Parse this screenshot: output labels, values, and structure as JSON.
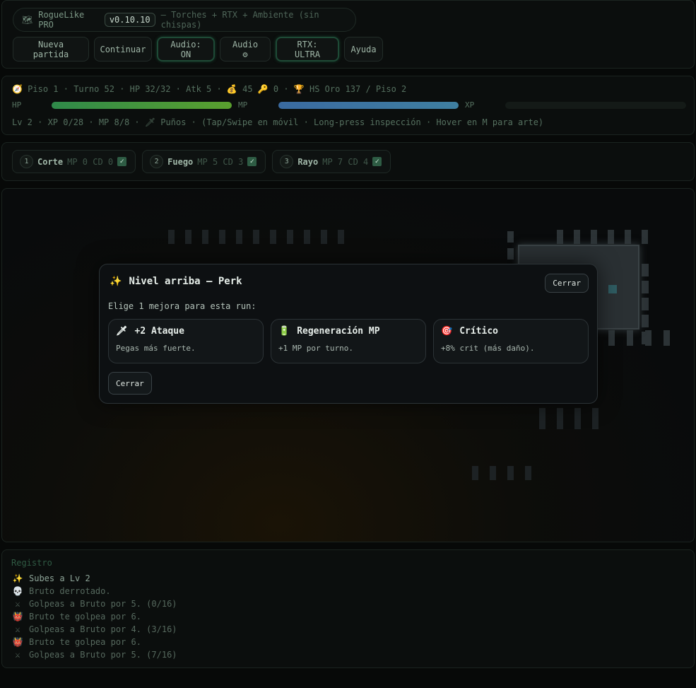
{
  "header": {
    "icon": "map-icon",
    "app_name": "RogueLike PRO",
    "version": "v0.10.10",
    "subtitle": "— Torches + RTX + Ambiente (sin chispas)",
    "buttons": {
      "new_game": "Nueva partida",
      "continue": "Continuar",
      "audio_toggle": "Audio: ON",
      "audio_settings": "Audio ⚙",
      "rtx": "RTX: ULTRA",
      "help": "Ayuda"
    }
  },
  "stats": {
    "line": "🧭 Piso 1 · Turno 52 · HP 32/32 · Atk 5 · 💰 45 🔑 0 · 🏆 HS Oro 137 / Piso 2",
    "hp_label": "HP",
    "mp_label": "MP",
    "xp_label": "XP",
    "hp_fraction": 1.0,
    "mp_fraction": 1.0,
    "xp_fraction": 0.0,
    "hp_color": "#5aa02e",
    "mp_color": "#3f7fa0",
    "subline": "Lv 2 · XP 0/28 · MP 8/8 · 🗡 Puños · (Tap/Swipe en móvil · Long-press inspección · Hover en M para arte)"
  },
  "skills": [
    {
      "key": "1",
      "name": "Corte",
      "meta": "MP 0  CD 0"
    },
    {
      "key": "2",
      "name": "Fuego",
      "meta": "MP 5  CD 3"
    },
    {
      "key": "3",
      "name": "Rayo",
      "meta": "MP 7  CD 4"
    }
  ],
  "modal": {
    "title": "Nivel arriba — Perk",
    "close_top": "Cerrar",
    "subtitle": "Elige 1 mejora para esta run:",
    "perks": [
      {
        "icon": "dagger-icon",
        "glyph": "🗡",
        "name": "+2 Ataque",
        "desc": "Pegas más fuerte."
      },
      {
        "icon": "battery-icon",
        "glyph": "🔋",
        "name": "Regeneración MP",
        "desc": "+1 MP por turno."
      },
      {
        "icon": "target-icon",
        "glyph": "🎯",
        "name": "Crítico",
        "desc": "+8% crit (más daño)."
      }
    ],
    "close_bottom": "Cerrar"
  },
  "log": {
    "title": "Registro",
    "entries": [
      {
        "icon": "sparkles-icon",
        "glyph": "✨",
        "text": "Subes a Lv 2"
      },
      {
        "icon": "skull-icon",
        "glyph": "💀",
        "text": "Bruto derrotado."
      },
      {
        "icon": "swords-icon",
        "glyph": "⚔",
        "text": "Golpeas a Bruto por 5. (0/16)"
      },
      {
        "icon": "ogre-icon",
        "glyph": "👹",
        "text": "Bruto te golpea por 6."
      },
      {
        "icon": "swords-icon",
        "glyph": "⚔",
        "text": "Golpeas a Bruto por 4. (3/16)"
      },
      {
        "icon": "ogre-icon",
        "glyph": "👹",
        "text": "Bruto te golpea por 6."
      },
      {
        "icon": "swords-icon",
        "glyph": "⚔",
        "text": "Golpeas a Bruto por 5. (7/16)"
      }
    ]
  }
}
